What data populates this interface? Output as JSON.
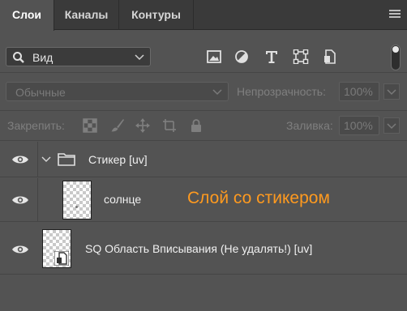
{
  "tabs": [
    {
      "label": "Слои",
      "active": true
    },
    {
      "label": "Каналы",
      "active": false
    },
    {
      "label": "Контуры",
      "active": false
    }
  ],
  "filter": {
    "value": "Вид",
    "icons": [
      "image-filter-icon",
      "adjustment-filter-icon",
      "type-filter-icon",
      "shape-filter-icon",
      "smart-object-filter-icon"
    ]
  },
  "blend": {
    "mode": "Обычные",
    "opacity_label": "Непрозрачность:",
    "opacity_value": "100%"
  },
  "lock": {
    "label": "Закрепить:",
    "fill_label": "Заливка:",
    "fill_value": "100%"
  },
  "layers": [
    {
      "name": "Стикер [uv]",
      "type": "group",
      "visible": true
    },
    {
      "name": "солнце",
      "type": "layer",
      "visible": true
    },
    {
      "name": "SQ Область Вписывания (Не удалять!) [uv]",
      "type": "smart-object",
      "visible": true
    }
  ],
  "annotation": "Слой со стикером",
  "colors": {
    "annotation": "#ff9a1f",
    "panel": "#535353",
    "tabbar": "#3a3a3a"
  }
}
